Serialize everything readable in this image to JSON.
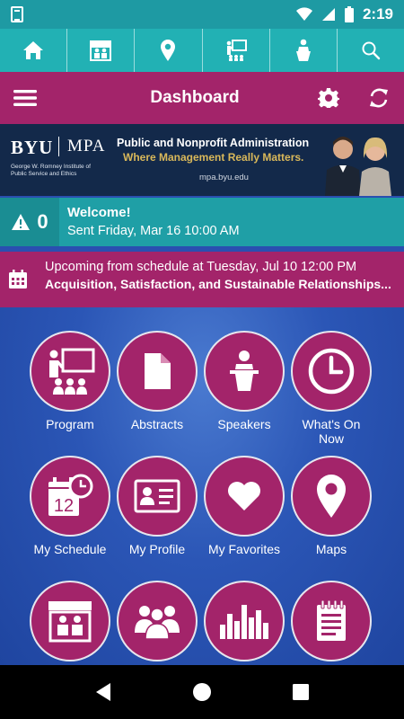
{
  "status_bar": {
    "time": "2:19"
  },
  "top_nav": {
    "items": [
      {
        "icon": "home-icon"
      },
      {
        "icon": "exhibitor-booth-icon"
      },
      {
        "icon": "map-pin-icon"
      },
      {
        "icon": "presentation-icon"
      },
      {
        "icon": "speaker-podium-icon"
      },
      {
        "icon": "search-icon"
      }
    ]
  },
  "title_bar": {
    "title": "Dashboard"
  },
  "banner": {
    "brand": "BYU",
    "program": "MPA",
    "institute": "George W. Romney Institute of Public Service and Ethics",
    "headline": "Public and Nonprofit Administration",
    "tagline": "Where Management Really Matters.",
    "url": "mpa.byu.edu"
  },
  "welcome": {
    "alert_count": "0",
    "title": "Welcome!",
    "subtitle": "Sent Friday, Mar 16 10:00 AM"
  },
  "upcoming": {
    "line1": "Upcoming from schedule at Tuesday, Jul 10 12:00 PM",
    "line2": "Acquisition, Satisfaction, and Sustainable Relationships..."
  },
  "tiles": [
    {
      "label": "Program",
      "icon": "presentation-icon"
    },
    {
      "label": "Abstracts",
      "icon": "document-icon"
    },
    {
      "label": "Speakers",
      "icon": "podium-icon"
    },
    {
      "label": "What's On Now",
      "icon": "clock-icon"
    },
    {
      "label": "My Schedule",
      "icon": "calendar-icon"
    },
    {
      "label": "My Profile",
      "icon": "id-card-icon"
    },
    {
      "label": "My Favorites",
      "icon": "heart-icon"
    },
    {
      "label": "Maps",
      "icon": "map-pin-icon"
    },
    {
      "label": "",
      "icon": "exhibitor-booth-icon"
    },
    {
      "label": "",
      "icon": "group-icon"
    },
    {
      "label": "",
      "icon": "city-icon"
    },
    {
      "label": "",
      "icon": "notepad-icon"
    }
  ],
  "colors": {
    "teal": "#22b1b4",
    "magenta": "#a3246a",
    "blue": "#2a4fb0"
  }
}
